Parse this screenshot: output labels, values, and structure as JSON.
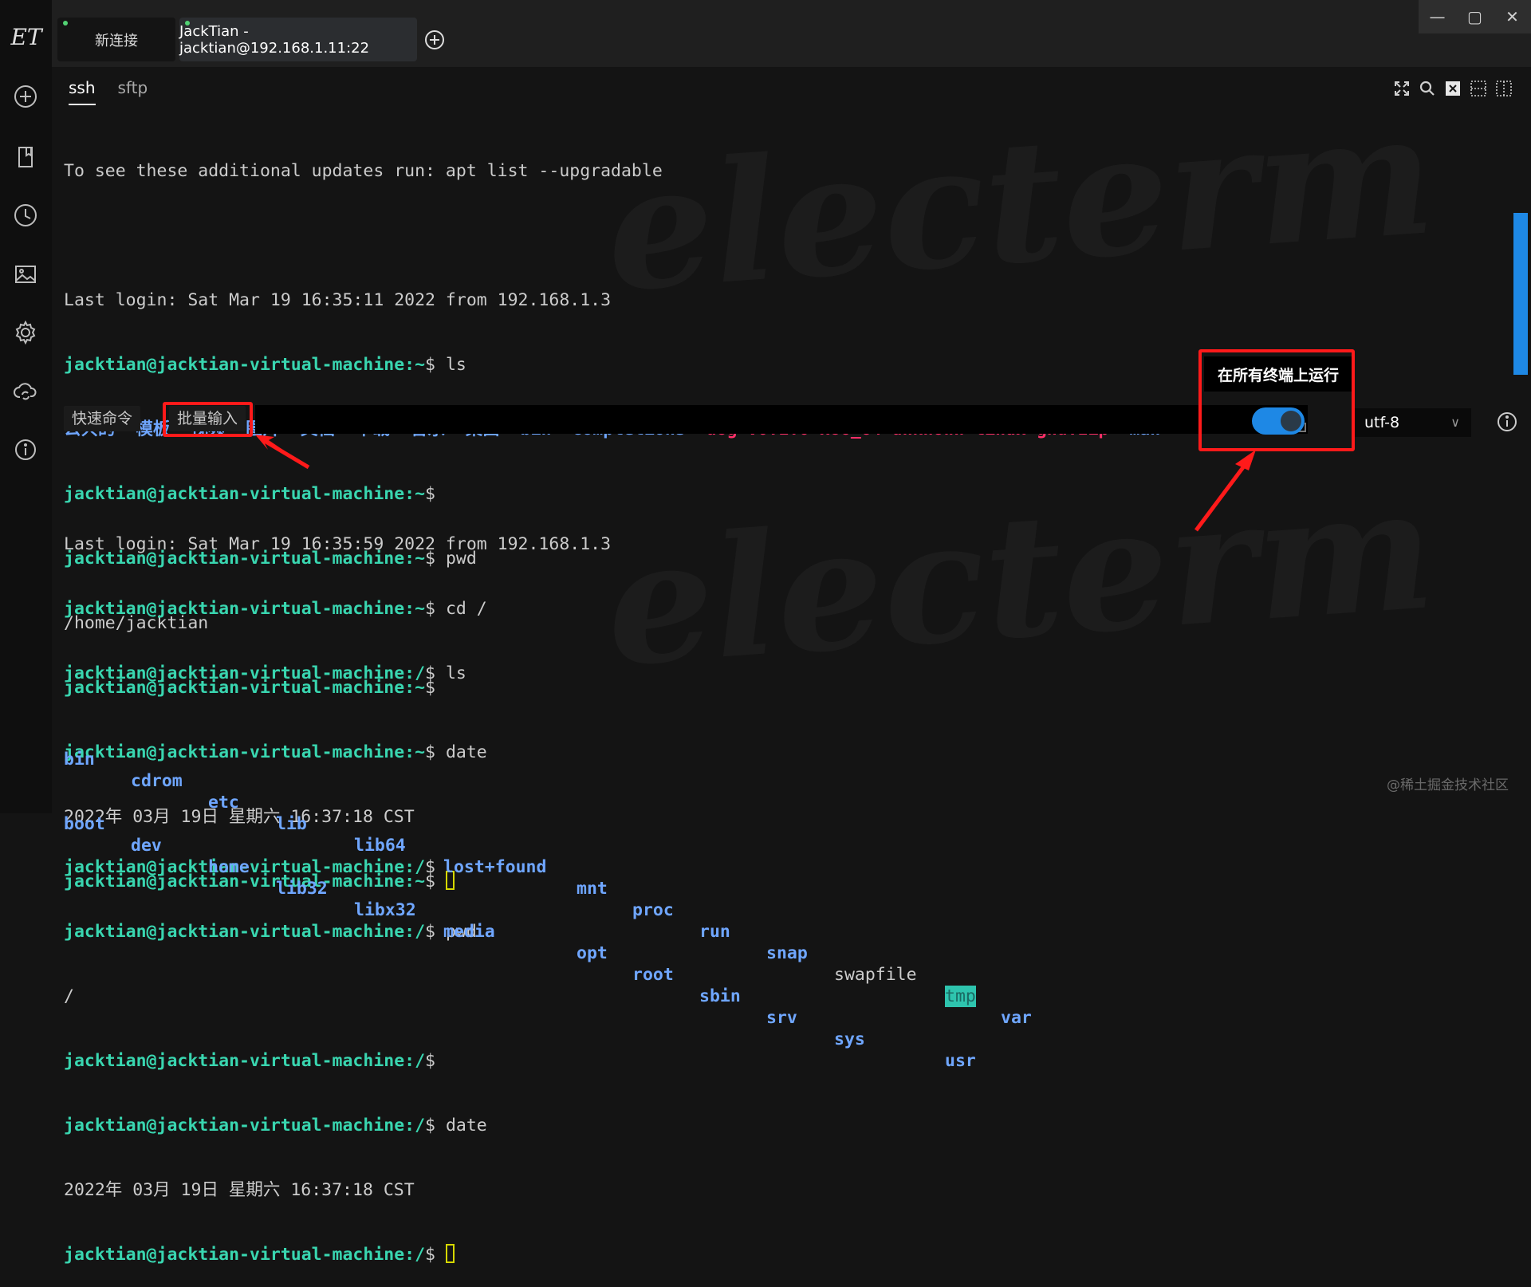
{
  "window": {
    "minimize": "—",
    "maximize": "▢",
    "close": "✕"
  },
  "app": {
    "logo_text": "ET"
  },
  "tabs": [
    {
      "label": "新连接"
    },
    {
      "label": "JackTian - jacktian@192.168.1.11:22"
    }
  ],
  "subtabs": [
    {
      "label": "ssh"
    },
    {
      "label": "sftp"
    }
  ],
  "terminal_top": {
    "line1": "To see these additional updates run: apt list --upgradable",
    "line2": "Last login: Sat Mar 19 16:35:11 2022 from 192.168.1.3",
    "prompt": "jacktian@jacktian-virtual-machine:~",
    "dollar": "$",
    "cmd_ls": " ls",
    "ls_dirs_cn": "公共的  模板  视频  图片  文档  下载  音乐  桌面",
    "ls_bin": "bin",
    "ls_completions": "completions",
    "ls_zip": "dog-v0.1.0-x86_64-unknown-linux-gnu.zip",
    "ls_man": "man",
    "cmd_pwd": " pwd",
    "pwd_out": "/home/jacktian",
    "cmd_date": " date",
    "date_out": "2022年 03月 19日 星期六 16:37:18 CST"
  },
  "quickbar": {
    "quick_cmd": "快速命令",
    "batch_input": "批量输入",
    "tooltip": "在所有终端上运行",
    "toggle_on": true,
    "encoding": "utf-8",
    "encoding_arrow": "∨"
  },
  "terminal_bottom": {
    "line1": "Last login: Sat Mar 19 16:35:59 2022 from 192.168.1.3",
    "prompt_home": "jacktian@jacktian-virtual-machine:~",
    "prompt_root": "jacktian@jacktian-virtual-machine:/",
    "dollar": "$",
    "cmd_cd": " cd /",
    "cmd_ls": " ls",
    "row1": [
      "bin",
      "cdrom",
      "etc",
      "lib",
      "lib64",
      "lost+found",
      "mnt",
      "proc",
      "run",
      "snap",
      "swapfile",
      "tmp",
      "var"
    ],
    "row2": [
      "boot",
      "dev",
      "home",
      "lib32",
      "libx32",
      "media",
      "opt",
      "root",
      "sbin",
      "srv",
      "sys",
      "usr"
    ],
    "cmd_pwd": " pwd",
    "pwd_out": "/",
    "cmd_date": " date",
    "date_out": "2022年 03月 19日 星期六 16:37:18 CST"
  },
  "watermark": {
    "text": "electerm"
  },
  "credit": "@稀土掘金技术社区",
  "colors": {
    "prompt": "#39d6b0",
    "directory": "#6fa6ff",
    "archive": "#ff2f68",
    "accent": "#1e88e5",
    "annotation": "#ff1a1a"
  }
}
